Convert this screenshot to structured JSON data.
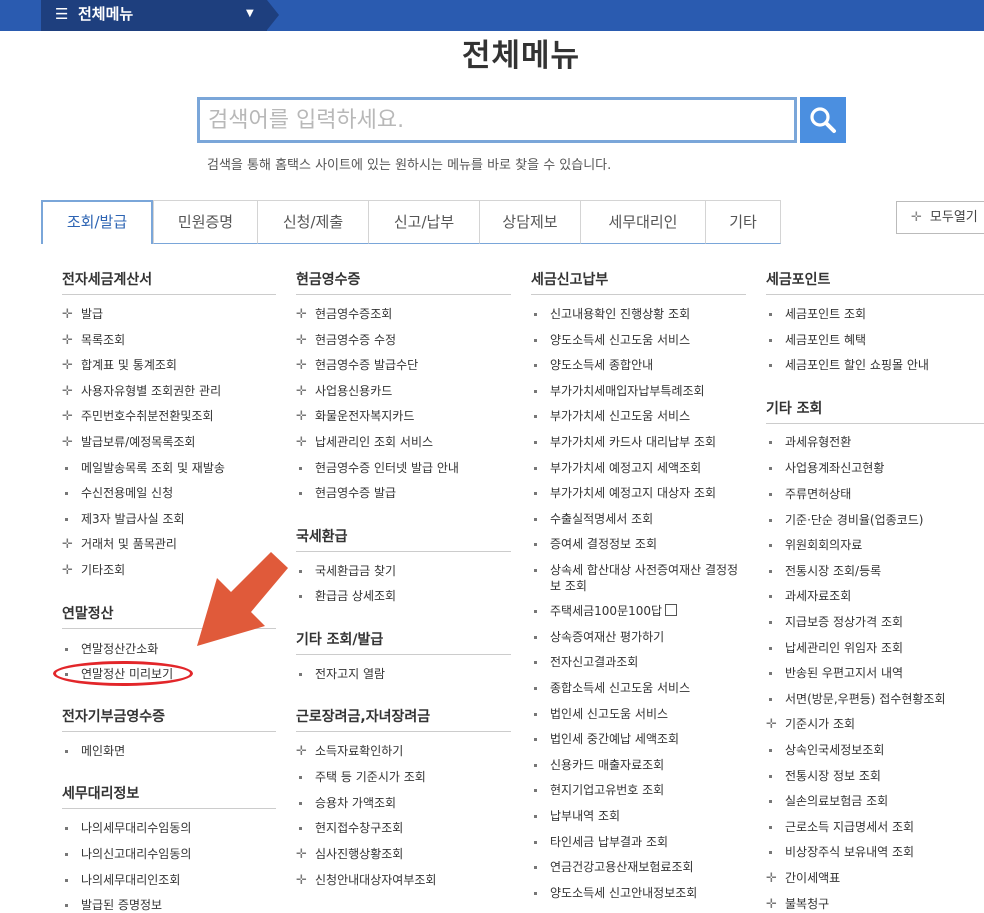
{
  "topbar": {
    "menu_label": "전체메뉴"
  },
  "page_title": "전체메뉴",
  "search": {
    "placeholder": "검색어를 입력하세요.",
    "description": "검색을 통해 홈택스 사이트에 있는 원하시는 메뉴를 바로 찾을 수 있습니다."
  },
  "tabs": [
    "조회/발급",
    "민원증명",
    "신청/제출",
    "신고/납부",
    "상담제보",
    "세무대리인",
    "기타"
  ],
  "expand_all": "모두열기",
  "columns": {
    "c1": {
      "s1": {
        "title": "전자세금계산서",
        "items": [
          "발급",
          "목록조회",
          "합계표 및 통계조회",
          "사용자유형별 조회권한 관리",
          "주민번호수취분전환및조회",
          "발급보류/예정목록조회",
          "메일발송목록 조회 및 재발송",
          "수신전용메일 신청",
          "제3자 발급사실 조회",
          "거래처 및 품목관리",
          "기타조회"
        ]
      },
      "s2": {
        "title": "연말정산",
        "items": [
          "연말정산간소화",
          "연말정산 미리보기"
        ]
      },
      "s3": {
        "title": "전자기부금영수증",
        "items": [
          "메인화면"
        ]
      },
      "s4": {
        "title": "세무대리정보",
        "items": [
          "나의세무대리수임동의",
          "나의신고대리수임동의",
          "나의세무대리인조회",
          "발급된 증명정보"
        ]
      }
    },
    "c2": {
      "s1": {
        "title": "현금영수증",
        "items": [
          "현금영수증조회",
          "현금영수증 수정",
          "현금영수증 발급수단",
          "사업용신용카드",
          "화물운전자복지카드",
          "납세관리인 조회 서비스",
          "현금영수증 인터넷 발급 안내",
          "현금영수증 발급"
        ]
      },
      "s2": {
        "title": "국세환급",
        "items": [
          "국세환급금 찾기",
          "환급금 상세조회"
        ]
      },
      "s3": {
        "title": "기타 조회/발급",
        "items": [
          "전자고지 열람"
        ]
      },
      "s4": {
        "title": "근로장려금,자녀장려금",
        "items": [
          "소득자료확인하기",
          "주택 등 기준시가 조회",
          "승용차 가액조회",
          "현지접수창구조회",
          "심사진행상황조회",
          "신청안내대상자여부조회"
        ]
      }
    },
    "c3": {
      "s1": {
        "title": "세금신고납부",
        "items": [
          "신고내용확인 진행상황 조회",
          "양도소득세 신고도움 서비스",
          "양도소득세 종합안내",
          "부가가치세매입자납부특례조회",
          "부가가치세 신고도움 서비스",
          "부가가치세 카드사 대리납부 조회",
          "부가가치세 예정고지 세액조회",
          "부가가치세 예정고지 대상자 조회",
          "수출실적명세서 조회",
          "증여세 결정정보 조회",
          "상속세 합산대상 사전증여재산 결정정",
          "보 조회",
          "주택세금100문100답",
          "상속증여재산 평가하기",
          "전자신고결과조회",
          "종합소득세 신고도움 서비스",
          "법인세 신고도움 서비스",
          "법인세 중간예납 세액조회",
          "신용카드 매출자료조회",
          "현지기업고유번호 조회",
          "납부내역 조회",
          "타인세금 납부결과 조회",
          "연금건강고용산재보험료조회",
          "양도소득세 신고안내정보조회"
        ]
      }
    },
    "c4": {
      "s1": {
        "title": "세금포인트",
        "items": [
          "세금포인트 조회",
          "세금포인트 혜택",
          "세금포인트 할인 쇼핑몰 안내"
        ]
      },
      "s2": {
        "title": "기타 조회",
        "items": [
          "과세유형전환",
          "사업용계좌신고현황",
          "주류면허상태",
          "기준·단순 경비율(업종코드)",
          "위원회회의자료",
          "전통시장 조회/등록",
          "과세자료조회",
          "지급보증 정상가격 조회",
          "납세관리인 위임자 조회",
          "반송된 우편고지서 내역",
          "서면(방문,우편등) 접수현황조회",
          "기준시가 조회",
          "상속인국세정보조회",
          "전통시장 정보 조회",
          "실손의료보험금 조회",
          "근로소득 지급명세서 조회",
          "비상장주식 보유내역 조회",
          "간이세액표",
          "불복청구"
        ]
      }
    }
  }
}
